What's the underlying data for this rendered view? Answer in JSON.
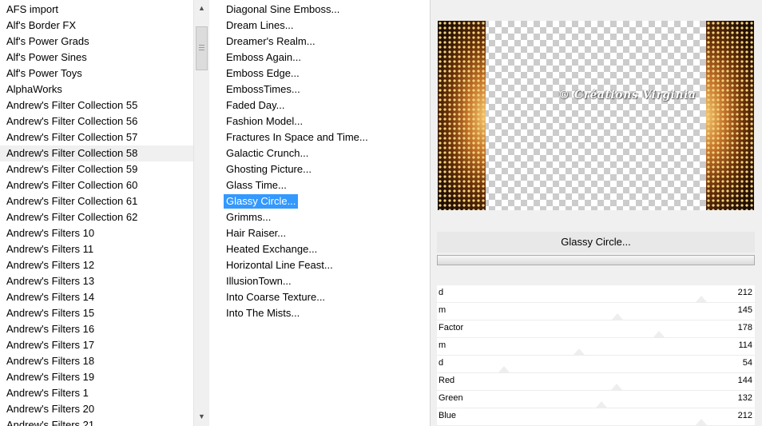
{
  "categories": {
    "items": [
      "AFS import",
      "Alf's Border FX",
      "Alf's Power Grads",
      "Alf's Power Sines",
      "Alf's Power Toys",
      "AlphaWorks",
      "Andrew's Filter Collection 55",
      "Andrew's Filter Collection 56",
      "Andrew's Filter Collection 57",
      "Andrew's Filter Collection 58",
      "Andrew's Filter Collection 59",
      "Andrew's Filter Collection 60",
      "Andrew's Filter Collection 61",
      "Andrew's Filter Collection 62",
      "Andrew's Filters 10",
      "Andrew's Filters 11",
      "Andrew's Filters 12",
      "Andrew's Filters 13",
      "Andrew's Filters 14",
      "Andrew's Filters 15",
      "Andrew's Filters 16",
      "Andrew's Filters 17",
      "Andrew's Filters 18",
      "Andrew's Filters 19",
      "Andrew's Filters 1",
      "Andrew's Filters 20",
      "Andrew's Filters 21"
    ],
    "selected_index": 9
  },
  "scrollbar": {
    "up_icon": "▲",
    "down_icon": "▼"
  },
  "filters": {
    "items": [
      "Diagonal Sine Emboss...",
      "Dream Lines...",
      "Dreamer's Realm...",
      "Emboss Again...",
      "Emboss Edge...",
      "EmbossTimes...",
      "Faded Day...",
      "Fashion Model...",
      "Fractures In Space and Time...",
      "Galactic Crunch...",
      "Ghosting Picture...",
      "Glass Time...",
      "Glassy Circle...",
      "Grimms...",
      "Hair Raiser...",
      "Heated Exchange...",
      "Horizontal Line Feast...",
      "IllusionTown...",
      "Into Coarse Texture...",
      "Into The Mists..."
    ],
    "selected_index": 12
  },
  "selected_filter_title": "Glassy Circle...",
  "sliders": [
    {
      "label": "d",
      "value": 212
    },
    {
      "label": "m",
      "value": 145
    },
    {
      "label": "Factor",
      "value": 178
    },
    {
      "label": "m",
      "value": 114
    },
    {
      "label": "d",
      "value": 54
    },
    {
      "label": "Red",
      "value": 144
    },
    {
      "label": "Green",
      "value": 132
    },
    {
      "label": "Blue",
      "value": 212
    }
  ],
  "watermark": "© Créations Virginia"
}
